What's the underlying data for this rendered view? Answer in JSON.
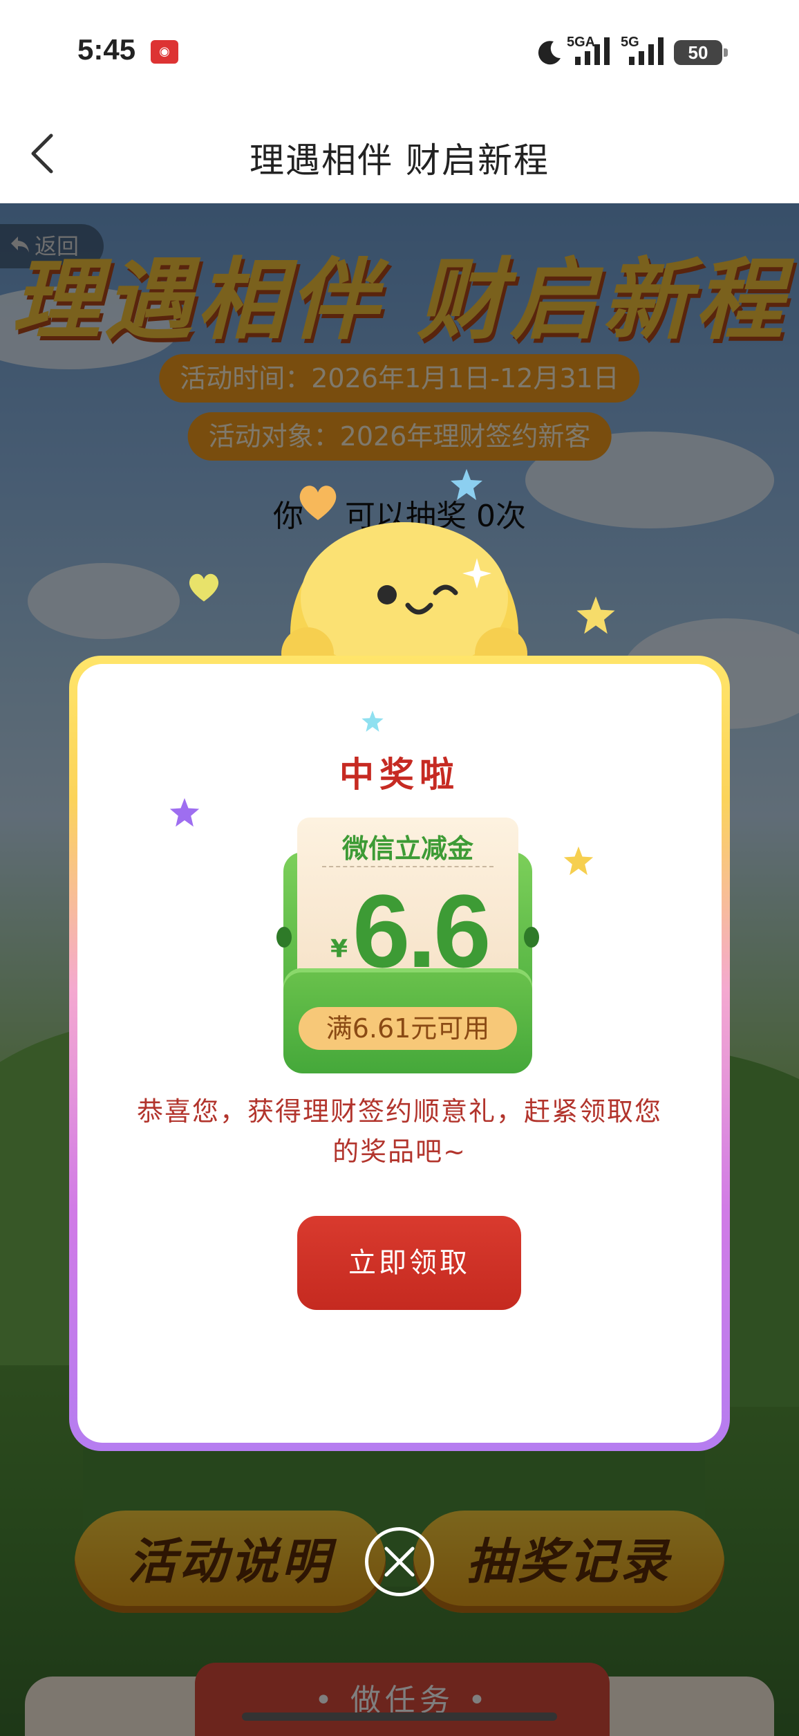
{
  "status_bar": {
    "time": "5:45",
    "network_1": "5GA",
    "network_2": "5G",
    "battery": "50",
    "icons": [
      "app-notification-icon",
      "moon-icon",
      "signal-icon",
      "signal-icon",
      "battery-icon"
    ]
  },
  "nav": {
    "back_icon": "chevron-left-icon",
    "title": "理遇相伴 财启新程"
  },
  "background": {
    "back_label": "返回",
    "banner_title": "理遇相伴 财启新程",
    "activity_time": "活动时间：2026年1月1日-12月31日",
    "activity_target": "活动对象：2026年理财签约新客",
    "draws_prefix": "你",
    "draws_suffix": "可以抽奖 0次",
    "rules_button": "活动说明",
    "records_button": "抽奖记录",
    "task_tab": "• 做任务 •"
  },
  "modal": {
    "title": "中奖啦",
    "coupon": {
      "label": "微信立减金",
      "currency": "¥",
      "amount": "6.6",
      "condition": "满6.61元可用"
    },
    "message": "恭喜您，获得理财签约顺意礼，赶紧领取您的奖品吧~",
    "claim_button": "立即领取",
    "close_icon": "close-icon"
  },
  "colors": {
    "accent_red": "#c62a22",
    "coupon_green": "#3d9b35",
    "claim_button": "#d0322a"
  }
}
